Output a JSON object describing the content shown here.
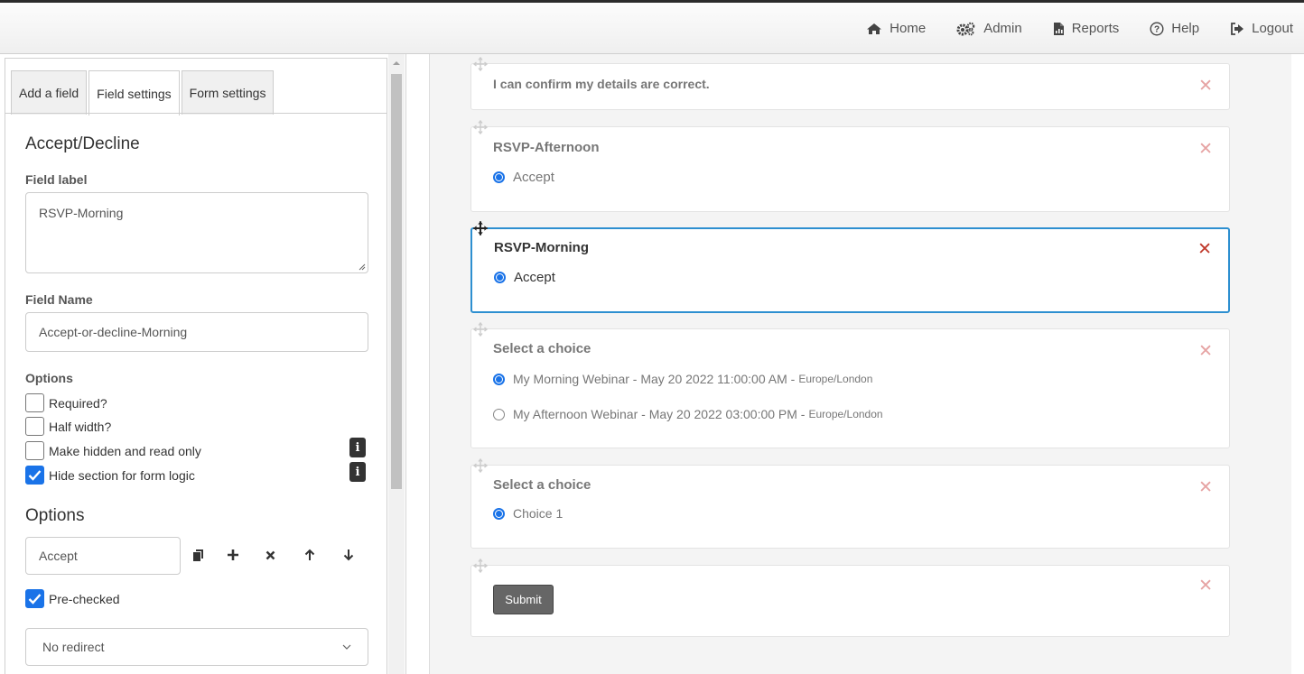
{
  "nav": {
    "home": "Home",
    "admin": "Admin",
    "reports": "Reports",
    "help": "Help",
    "logout": "Logout"
  },
  "sidebar": {
    "tabs": [
      {
        "label": "Add a field"
      },
      {
        "label": "Field settings"
      },
      {
        "label": "Form settings"
      }
    ],
    "active_tab": "Field settings",
    "section_title": "Accept/Decline",
    "field_label": {
      "label": "Field label",
      "value": "RSVP-Morning"
    },
    "field_name": {
      "label": "Field Name",
      "value": "Accept-or-decline-Morning"
    },
    "options_label": "Options",
    "checkboxes": [
      {
        "label": "Required?",
        "checked": false
      },
      {
        "label": "Half width?",
        "checked": false
      },
      {
        "label": "Make hidden and read only",
        "checked": false
      },
      {
        "label": "Hide section for form logic",
        "checked": true
      }
    ],
    "options_title": "Options",
    "option_value": "Accept",
    "prechecked": {
      "label": "Pre-checked",
      "checked": true
    },
    "redirect": "No redirect"
  },
  "form": {
    "cards": [
      {
        "title": "I can confirm my details are correct."
      },
      {
        "title": "RSVP-Afternoon",
        "options": [
          "Accept"
        ]
      },
      {
        "title": "RSVP-Morning",
        "options": [
          "Accept"
        ],
        "selected": true
      },
      {
        "title": "Select a choice",
        "options": [
          {
            "text": "My Morning Webinar - May 20 2022 11:00:00 AM - ",
            "tz": "Europe/London",
            "checked": true
          },
          {
            "text": "My Afternoon Webinar - May 20 2022 03:00:00 PM - ",
            "tz": "Europe/London",
            "checked": false
          }
        ]
      },
      {
        "title": "Select a choice",
        "options": [
          "Choice 1"
        ]
      },
      {
        "submit_label": "Submit"
      }
    ],
    "close_glyph": "✕"
  },
  "colors": {
    "accent": "#1a73e8",
    "selected_border": "#2d8fd0",
    "delete_active": "#c0392b",
    "delete_faded": "#e6a3a3"
  }
}
